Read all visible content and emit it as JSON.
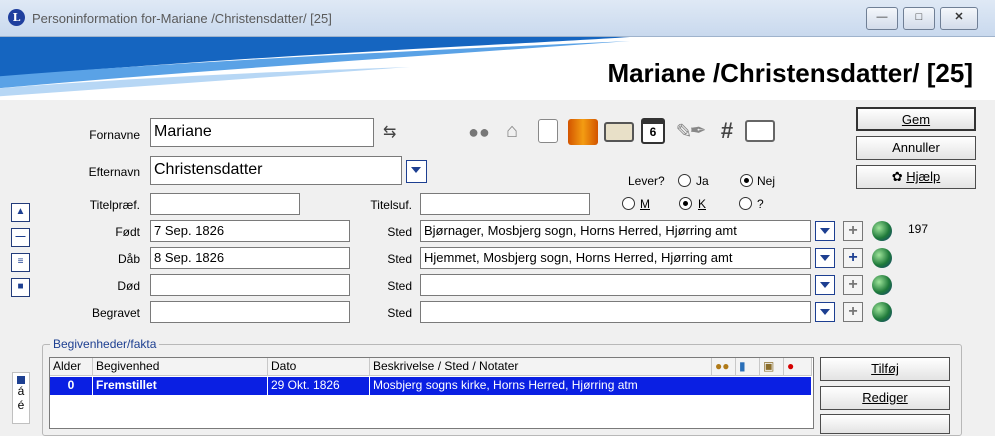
{
  "window": {
    "app_icon": "L",
    "title": "Personinformation for-Mariane /Christensdatter/ [25]",
    "controls": [
      "minimize-icon",
      "maximize-icon",
      "close-icon"
    ]
  },
  "banner": {
    "title": "Mariane /Christensdatter/ [25]"
  },
  "form": {
    "fornavne_label": "Fornavne",
    "fornavne_value": "Mariane",
    "efternavn_label": "Efternavn",
    "efternavn_value": "Christensdatter",
    "titelpraef_label": "Titelpræf.",
    "titelpraef_value": "",
    "titelsuf_label": "Titelsuf.",
    "titelsuf_value": "",
    "fodt_label": "Født",
    "fodt_date": "7 Sep. 1826",
    "fodt_sted_label": "Sted",
    "fodt_sted": "Bjørnager, Mosbjerg sogn, Horns Herred, Hjørring amt",
    "daab_label": "Dåb",
    "daab_date": "8 Sep. 1826",
    "daab_sted_label": "Sted",
    "daab_sted": "Hjemmet, Mosbjerg sogn, Horns Herred, Hjørring amt",
    "dod_label": "Død",
    "dod_date": "",
    "dod_sted_label": "Sted",
    "dod_sted": "",
    "begravet_label": "Begravet",
    "begravet_date": "",
    "begravet_sted_label": "Sted",
    "begravet_sted": "",
    "count": "197"
  },
  "status": {
    "lever_label": "Lever?",
    "ja": "Ja",
    "nej": "Nej",
    "lever_selected": "Nej",
    "m": "M",
    "k": "K",
    "unknown": "?",
    "sex_selected": "K"
  },
  "buttons": {
    "gem": "Gem",
    "annuller": "Annuller",
    "hjaelp": "Hjælp",
    "tilfoj": "Tilføj",
    "rediger": "Rediger"
  },
  "toolbar_icons": [
    "people-icon",
    "house-icon",
    "document-icon",
    "book-icon",
    "photo-icon",
    "calendar-icon",
    "notes-icon",
    "pen-icon",
    "hash-icon",
    "source-book-icon"
  ],
  "calendar_day": "6",
  "hash_glyph": "#",
  "events": {
    "group_title": "Begivenheder/fakta",
    "columns": [
      "Alder",
      "Begivenhed",
      "Dato",
      "Beskrivelse / Sted / Notater"
    ],
    "header_icons": [
      "people-icon",
      "book-icon",
      "photo-icon",
      "alert-icon"
    ],
    "rows": [
      {
        "alder": "0",
        "begivenhed": "Fremstillet",
        "dato": "29 Okt. 1826",
        "beskrivelse": "Mosbjerg sogns kirke, Horns Herred, Hjørring atm"
      }
    ]
  },
  "side_letters": [
    "á",
    "é"
  ],
  "colors": {
    "accent": "#1d3f91",
    "selection": "#0a1fe3",
    "banner_blue": "#1565c0"
  }
}
